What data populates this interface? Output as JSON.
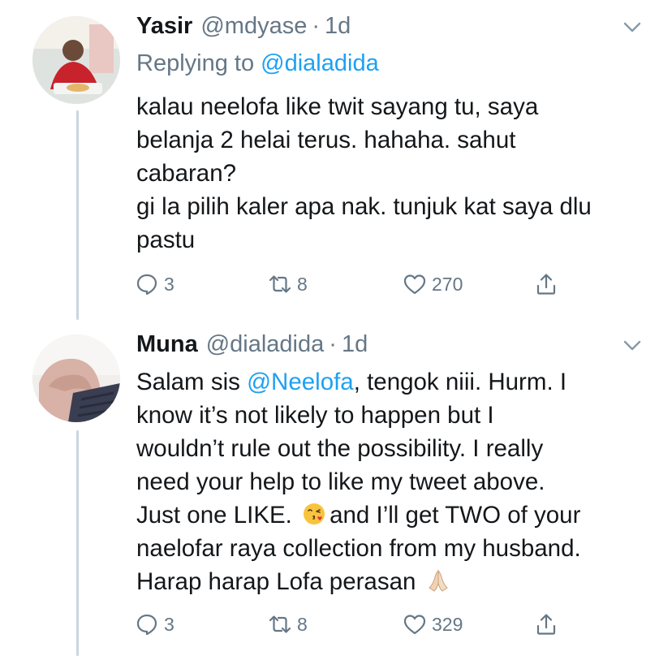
{
  "tweets": [
    {
      "name": "Yasir",
      "handle": "@mdyase",
      "separator": "·",
      "time": "1d",
      "reply_prefix": "Replying to",
      "reply_mention": "@dialadida",
      "lines": [
        "kalau neelofa like twit sayang tu, saya",
        "belanja 2 helai terus. hahaha. sahut",
        "cabaran?",
        "gi la pilih kaler apa nak. tunjuk kat saya dlu",
        "pastu"
      ],
      "reply_count": "3",
      "retweet_count": "8",
      "like_count": "270"
    },
    {
      "name": "Muna",
      "handle": "@dialadida",
      "separator": "·",
      "time": "1d",
      "line1_prefix": "Salam sis",
      "line1_mention": "@Neelofa",
      "line1_suffix": ", tengok niii. Hurm. I",
      "line2": "know it’s not likely to happen but I",
      "line3": "wouldn’t rule out the possibility. I really",
      "line4": "need your help to like my tweet above.",
      "line5_prefix": "Just one LIKE.",
      "line5_suffix": "and I’ll get TWO of your",
      "line6": "naelofar raya collection from my husband.",
      "line7": "Harap harap Lofa perasan",
      "reply_count": "3",
      "retweet_count": "8",
      "like_count": "329"
    }
  ],
  "icons": {
    "reply": "reply-icon",
    "retweet": "retweet-icon",
    "like": "heart-icon",
    "share": "share-icon",
    "menu": "chevron-down-icon",
    "emoji1": "kissing-face-emoji",
    "emoji2": "folded-hands-emoji"
  },
  "colors": {
    "link": "#1da1f2",
    "secondary": "#657786",
    "text": "#14171a",
    "thread_line": "#ccd6dd"
  }
}
